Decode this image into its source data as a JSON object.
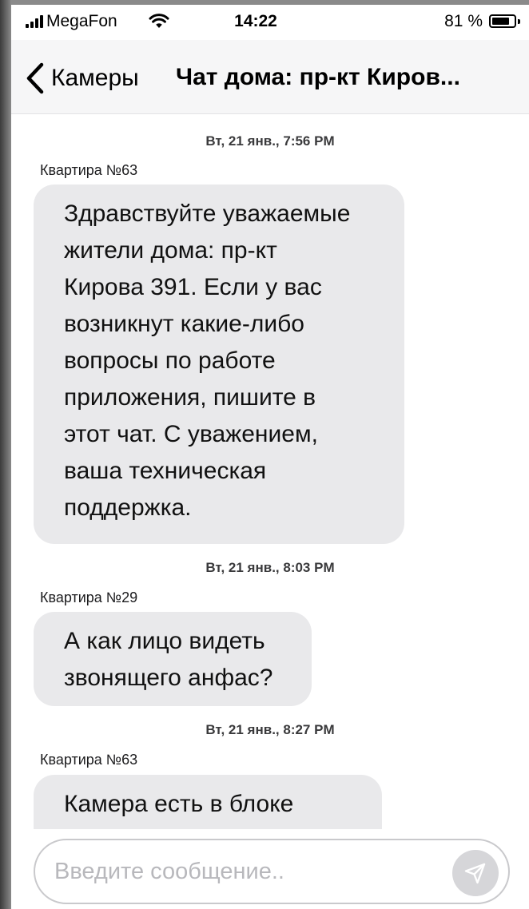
{
  "status_bar": {
    "carrier": "MegaFon",
    "time": "14:22",
    "battery_percent": "81 %",
    "battery_level": 0.81
  },
  "nav": {
    "back_label": "Камеры",
    "title": "Чат дома: пр-кт Киров..."
  },
  "messages": [
    {
      "timestamp": "Вт, 21 янв., 7:56 PM",
      "sender": "Квартира №63",
      "text": "Здравствуйте уважаемые\nжители дома: пр-кт\nКирова 391. Если у вас\nвозникнут какие-либо\nвопросы по работе\nприложения, пишите в\nэтот чат. С уважением,\nваша техническая\nподдержка."
    },
    {
      "timestamp": "Вт, 21 янв., 8:03 PM",
      "sender": "Квартира №29",
      "text": "А как лицо видеть\nзвонящего анфас?"
    },
    {
      "timestamp": "Вт, 21 янв., 8:27 PM",
      "sender": "Квартира №63",
      "text": "Камера есть в блоке"
    }
  ],
  "input": {
    "placeholder": "Введите сообщение.."
  },
  "colors": {
    "bubble": "#e9e9eb",
    "nav_background": "#f6f6f7",
    "send_button": "#d6d6d9"
  }
}
